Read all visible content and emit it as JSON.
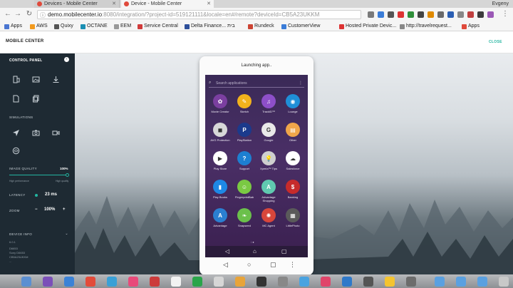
{
  "browser": {
    "tabs": [
      {
        "label": "Devices - Mobile Center",
        "active": false
      },
      {
        "label": "Device - Mobile Center",
        "active": true
      }
    ],
    "user": "Evgeny",
    "url_host": "demo.mobilecenter.io",
    "url_rest": ":8080/integration/?project-id=519121111&locale=en#/remote?deviceId=CB5A23UKKM",
    "bookmarks": [
      "Apps",
      "AWS",
      "Quixy",
      "OCTANE",
      "EEM",
      "Service Central",
      "Delta Finance... בית",
      "Rundeck",
      "CustomerView",
      "Hosted Private Devic...",
      "http://travelrequest...",
      "Apps"
    ]
  },
  "app": {
    "title": "MOBILE CENTER",
    "close_label": "CLOSE"
  },
  "panel": {
    "title": "CONTROL PANEL",
    "simulations_label": "SIMULATIONS",
    "image_quality_label": "IMAGE QUALITY",
    "image_quality_value": "100%",
    "image_quality_fraction": 1.0,
    "high_perf_label": "High performance",
    "high_quality_label": "High quality",
    "latency_label": "LATENCY",
    "latency_value": "23 ms",
    "zoom_label": "ZOOM",
    "zoom_minus": "−",
    "zoom_value": "100%",
    "zoom_plus": "+",
    "device_info_label": "DEVICE INFO",
    "device_info_lines": [
      "6.0.1",
      "D6653",
      "Sony D6653",
      "CB5A23UKKM"
    ],
    "more": "..."
  },
  "device": {
    "status": "Launching app..",
    "search_placeholder": "Search applications",
    "apps": [
      {
        "label": "Movie Creator",
        "color": "#7b3fa0",
        "glyph": "✿"
      },
      {
        "label": "Sketch",
        "color": "#f2b21c",
        "glyph": "✎"
      },
      {
        "label": "TrackID™",
        "color": "#8d4fc9",
        "glyph": "♫"
      },
      {
        "label": "Lounge",
        "color": "#1f8fd8",
        "glyph": "◉"
      },
      {
        "label": "AVG Protection",
        "color": "#d8d8d8",
        "glyph": "◼"
      },
      {
        "label": "PlayStation",
        "color": "#1b3a8c",
        "glyph": "P"
      },
      {
        "label": "Google",
        "color": "#e9e9e9",
        "glyph": "G"
      },
      {
        "label": "Other",
        "color": "#f0a64a",
        "glyph": "▤"
      },
      {
        "label": "Play Store",
        "color": "#ffffff",
        "glyph": "▶"
      },
      {
        "label": "Support",
        "color": "#1d7fd1",
        "glyph": "?"
      },
      {
        "label": "Xperia™ Tips",
        "color": "#cfcfcf",
        "glyph": "💡"
      },
      {
        "label": "Salesforce",
        "color": "#ffffff",
        "glyph": "☁"
      },
      {
        "label": "Play Books",
        "color": "#1e88e5",
        "glyph": "▮"
      },
      {
        "label": "FingerprintBab",
        "color": "#7ac943",
        "glyph": "☺"
      },
      {
        "label": "Advantage Shopping",
        "color": "#60c9b0",
        "glyph": "A"
      },
      {
        "label": "Banking",
        "color": "#c62b2b",
        "glyph": "$"
      },
      {
        "label": "Advantage",
        "color": "#2b7fd1",
        "glyph": "A"
      },
      {
        "label": "Snapseed",
        "color": "#6bc04b",
        "glyph": "❧"
      },
      {
        "label": "MC Agent",
        "color": "#d9463b",
        "glyph": "✺"
      },
      {
        "label": "LittlePhoto",
        "color": "#5a5a5a",
        "glyph": "▦"
      }
    ]
  }
}
